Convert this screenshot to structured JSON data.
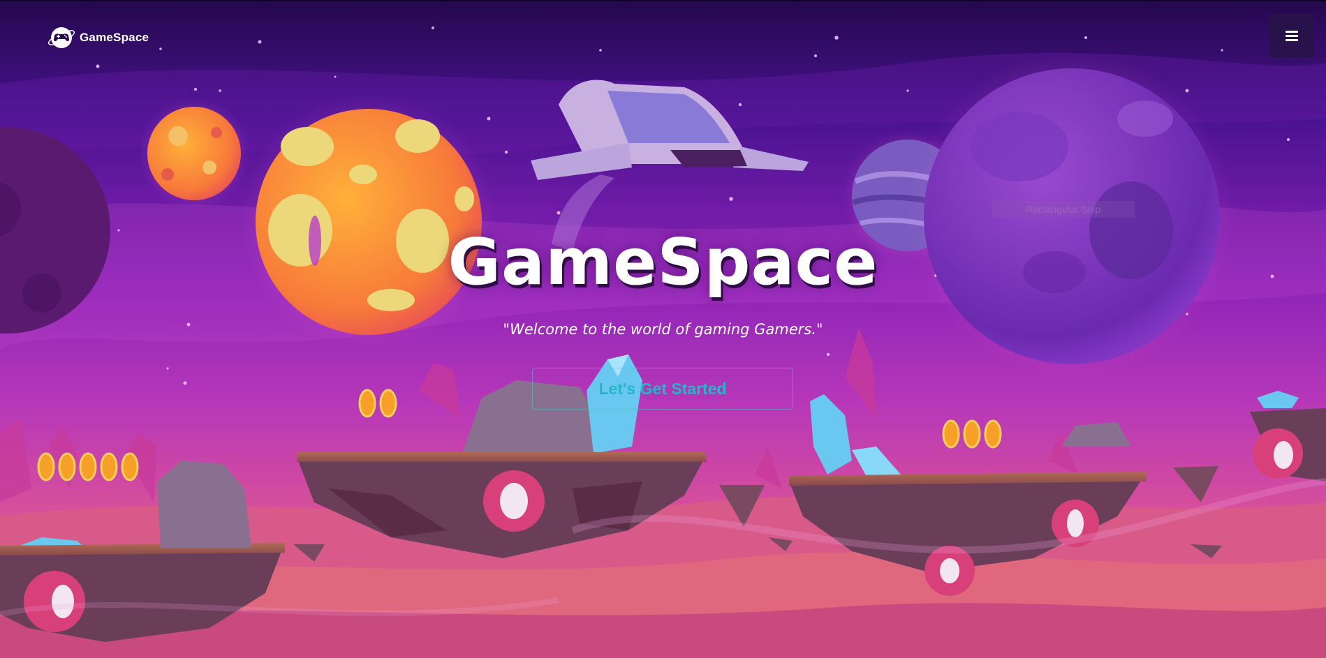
{
  "brand": {
    "name": "GameSpace",
    "logo_icon": "gamepad-icon"
  },
  "navbar": {
    "menu_icon": "hamburger-menu-icon"
  },
  "hero": {
    "title": "GameSpace",
    "subtitle": "\"Welcome to the world of gaming Gamers.\"",
    "cta_label": "Let's Get Started"
  },
  "overlay": {
    "snip_label": "Rectangular Snip"
  },
  "colors": {
    "sky_top": "#2a0a55",
    "sky_mid": "#8b1fb8",
    "ground": "#e0508a",
    "cta_text": "#26b6c8",
    "menu_bg": "#281446"
  }
}
